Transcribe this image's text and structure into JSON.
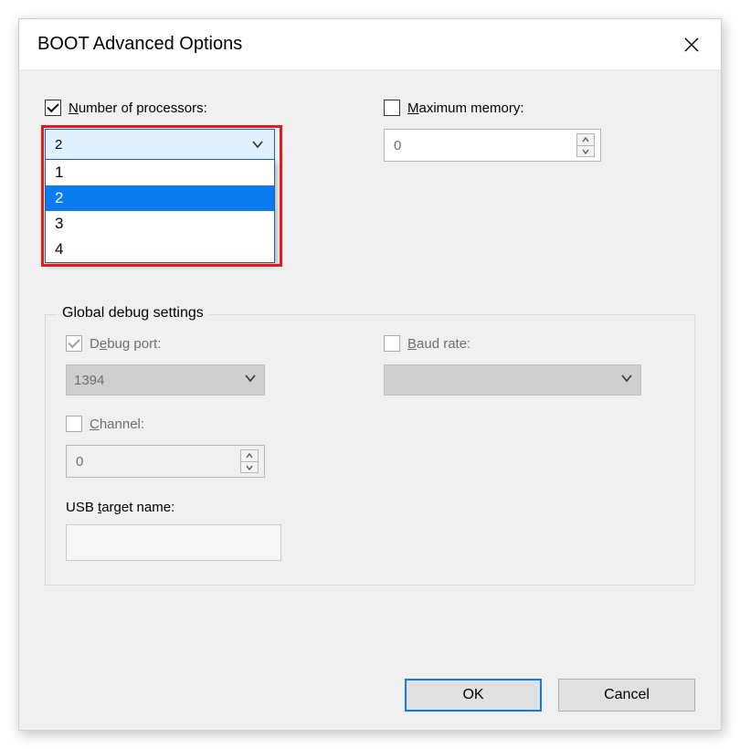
{
  "title": "BOOT Advanced Options",
  "processors": {
    "label_pre": "N",
    "label_rest": "umber of processors:",
    "checked": true,
    "selected": "2",
    "options": [
      "1",
      "2",
      "3",
      "4"
    ],
    "selected_index": 1
  },
  "memory": {
    "label_pre": "M",
    "label_rest": "aximum memory:",
    "checked": false,
    "value": "0"
  },
  "debug": {
    "legend": "Global debug settings",
    "port": {
      "label_pre": "D",
      "label_mid": "e",
      "label_rest": "bug port:",
      "checked": true,
      "value": "1394"
    },
    "baud": {
      "label_pre": "B",
      "label_rest": "aud rate:",
      "checked": false,
      "value": ""
    },
    "channel": {
      "label_pre": "C",
      "label_rest": "hannel:",
      "checked": false,
      "value": "0"
    },
    "usb": {
      "label_pre": "USB ",
      "label_ul": "t",
      "label_rest": "arget name:",
      "value": ""
    }
  },
  "buttons": {
    "ok": "OK",
    "cancel": "Cancel"
  }
}
